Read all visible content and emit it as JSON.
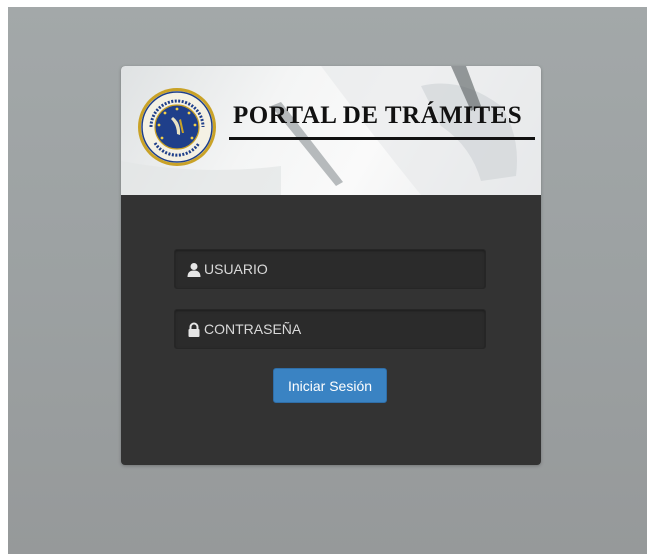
{
  "banner": {
    "title": "PORTAL DE TRÁMITES",
    "seal_icon": "secretaria-seguridad-publica-seal-icon"
  },
  "form": {
    "username": {
      "placeholder": "USUARIO",
      "value": "",
      "icon": "user-icon"
    },
    "password": {
      "placeholder": "CONTRASEÑA",
      "value": "",
      "icon": "lock-icon"
    },
    "submit_label": "Iniciar Sesión"
  },
  "colors": {
    "page_background": "#9ea3a4",
    "card_background": "#333333",
    "input_background": "#2b2b2b",
    "button_primary": "#3a83c3",
    "title_text": "#111111",
    "seal_blue": "#1f3f8a",
    "seal_gold": "#c9a227"
  }
}
